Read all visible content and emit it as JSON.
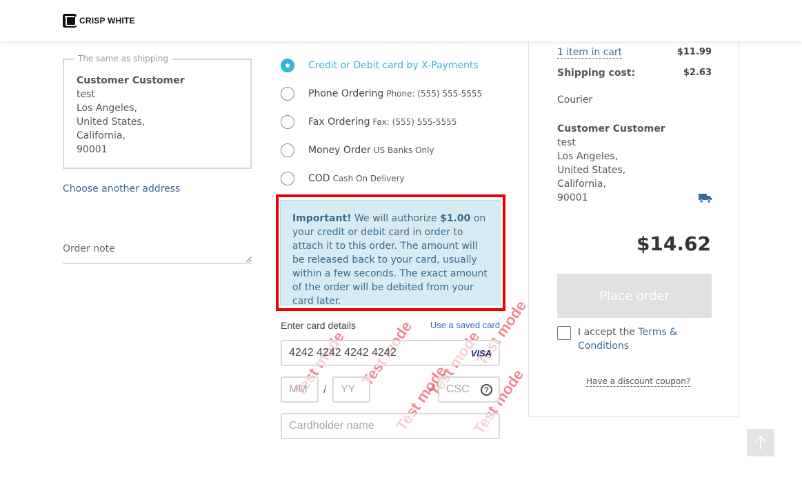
{
  "header": {
    "logo_text": "CRISP WHITE"
  },
  "billing": {
    "legend": "The same as shipping",
    "name": "Customer Customer",
    "lines": [
      "test",
      "Los Angeles,",
      "United States,",
      "California,",
      "90001"
    ],
    "choose_link": "Choose another address",
    "order_note_placeholder": "Order note"
  },
  "payment": {
    "methods": [
      {
        "label": "Credit or Debit card by X-Payments",
        "sub": "",
        "selected": true
      },
      {
        "label": "Phone Ordering",
        "sub": "Phone: (555) 555-5555",
        "selected": false
      },
      {
        "label": "Fax Ordering",
        "sub": "Fax: (555) 555-5555",
        "selected": false
      },
      {
        "label": "Money Order",
        "sub": "US Banks Only",
        "selected": false
      },
      {
        "label": "COD",
        "sub": "Cash On Delivery",
        "selected": false
      }
    ],
    "notice": {
      "important": "Important!",
      "text1": " We will authorize ",
      "amount": "$1.00",
      "text2": " on your credit or debit card in order to attach it to this order. The amount will be released back to your card, usually within a few seconds. The exact amount of the order will be debited from your card later."
    },
    "card": {
      "heading": "Enter card details",
      "saved_link": "Use a saved card",
      "number": "4242 4242 4242 4242",
      "brand": "VISA",
      "mm_placeholder": "MM",
      "slash": "/",
      "yy_placeholder": "YY",
      "csc_placeholder": "CSC",
      "help_glyph": "?",
      "holder_placeholder": "Cardholder name",
      "watermark": "Test mode"
    }
  },
  "summary": {
    "cart_link": "1 item in cart",
    "cart_value": "$11.99",
    "shipping_label": "Shipping cost:",
    "shipping_value": "$2.63",
    "courier": "Courier",
    "ship_name": "Customer Customer",
    "ship_lines": [
      "test",
      "Los Angeles,",
      "United States,",
      "California,",
      "90001"
    ],
    "total": "$14.62",
    "place_order": "Place order",
    "accept_prefix": "I accept the ",
    "terms_link": "Terms & Conditions",
    "coupon_link": "Have a discount coupon?"
  },
  "colors": {
    "accent": "#2fb8d8",
    "link": "#3b6a92",
    "notice_bg": "#d8ebf3",
    "highlight_border": "#ee0000"
  }
}
